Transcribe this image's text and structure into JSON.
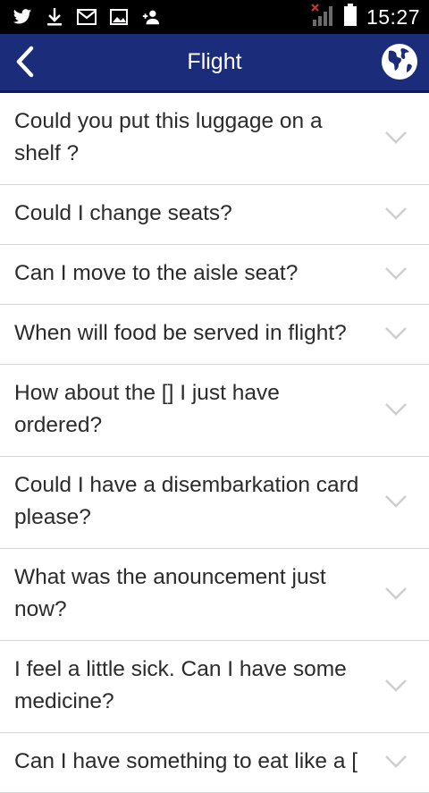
{
  "status_bar": {
    "time": "15:27",
    "icons": [
      "twitter-icon",
      "download-icon",
      "gmail-icon",
      "image-icon",
      "add-contact-icon",
      "no-signal-icon",
      "battery-icon"
    ]
  },
  "header": {
    "title": "Flight",
    "back_icon": "chevron-left-icon",
    "globe_icon": "globe-icon",
    "background": "#1b2c7a"
  },
  "items": [
    {
      "text": "Could you put this luggage on a shelf ?"
    },
    {
      "text": "Could I change seats?"
    },
    {
      "text": "Can I move to the aisle seat?"
    },
    {
      "text": "When will food be served in flight?"
    },
    {
      "text": "How about the [] I just have ordered?"
    },
    {
      "text": "Could I have a disembarkation card please?"
    },
    {
      "text": "What was the anouncement just now?"
    },
    {
      "text": "I feel a little sick. Can I have some medicine?"
    },
    {
      "text": "Can I have something to eat like a ["
    }
  ]
}
